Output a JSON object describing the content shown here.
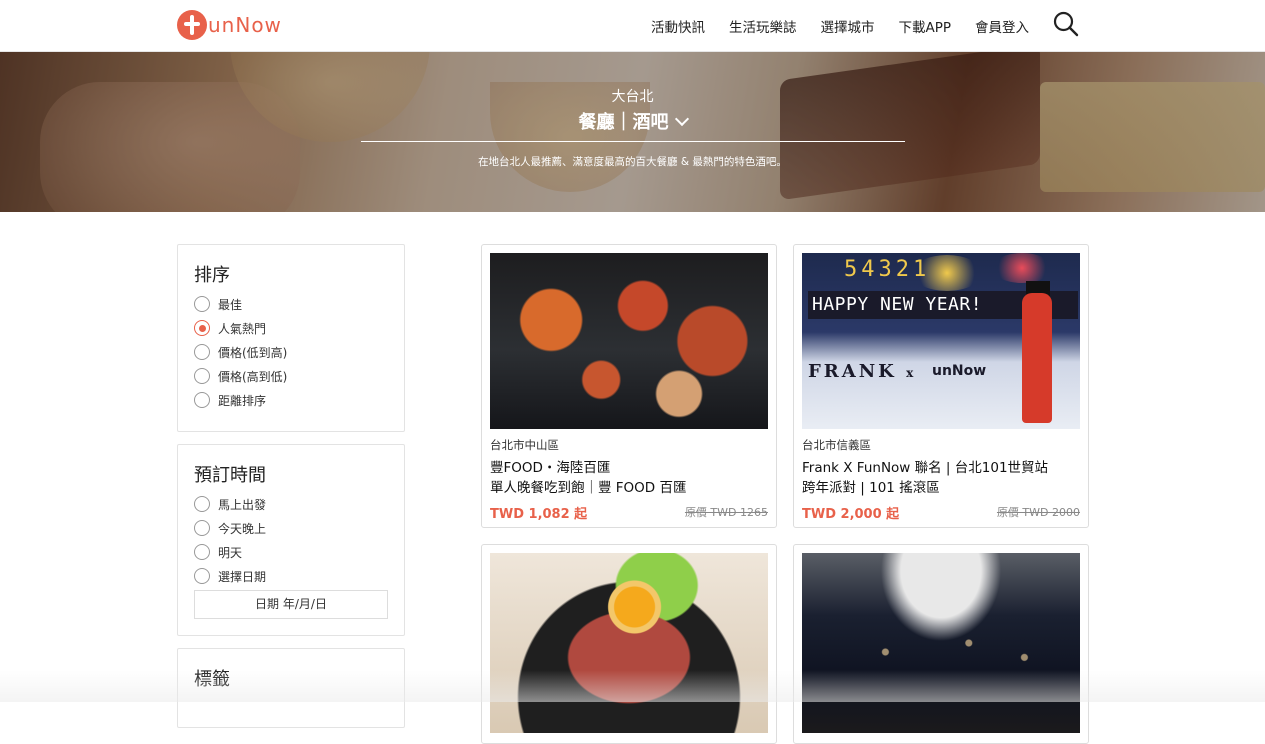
{
  "header": {
    "logo_text": "unNow",
    "nav": [
      "活動快訊",
      "生活玩樂誌",
      "選擇城市",
      "下載APP",
      "會員登入"
    ],
    "search_icon": "search-icon"
  },
  "hero": {
    "city": "大台北",
    "category": "餐廳｜酒吧",
    "description": "在地台北人最推薦、滿意度最高的百大餐廳 & 最熱門的特色酒吧。"
  },
  "sidebar": {
    "sort": {
      "title": "排序",
      "options": [
        "最佳",
        "人氣熱門",
        "價格(低到高)",
        "價格(高到低)",
        "距離排序"
      ],
      "selected": "人氣熱門"
    },
    "booking": {
      "title": "預訂時間",
      "options": [
        "馬上出發",
        "今天晚上",
        "明天",
        "選擇日期"
      ],
      "date_placeholder": "日期 年/月/日"
    },
    "tags": {
      "title": "標籤"
    }
  },
  "cards": [
    {
      "district": "台北市中山區",
      "title_line1": "豐FOOD・海陸百匯",
      "title_line2": "單人晚餐吃到飽｜豐 FOOD 百匯",
      "price": "TWD 1,082 起",
      "original": "原價 TWD 1265"
    },
    {
      "district": "台北市信義區",
      "title_line1": "Frank X FunNow 聯名 | 台北101世貿站",
      "title_line2": "跨年派對 | 101 搖滾區",
      "price": "TWD 2,000 起",
      "original": "原價 TWD 2000",
      "image_text": {
        "countdown": "54321",
        "banner": "HAPPY NEW YEAR!",
        "brand_left": "FRANK",
        "brand_x": "x",
        "brand_right": "unNow"
      }
    },
    {},
    {}
  ],
  "colors": {
    "accent": "#e8614a",
    "border": "#e3e3e3"
  }
}
